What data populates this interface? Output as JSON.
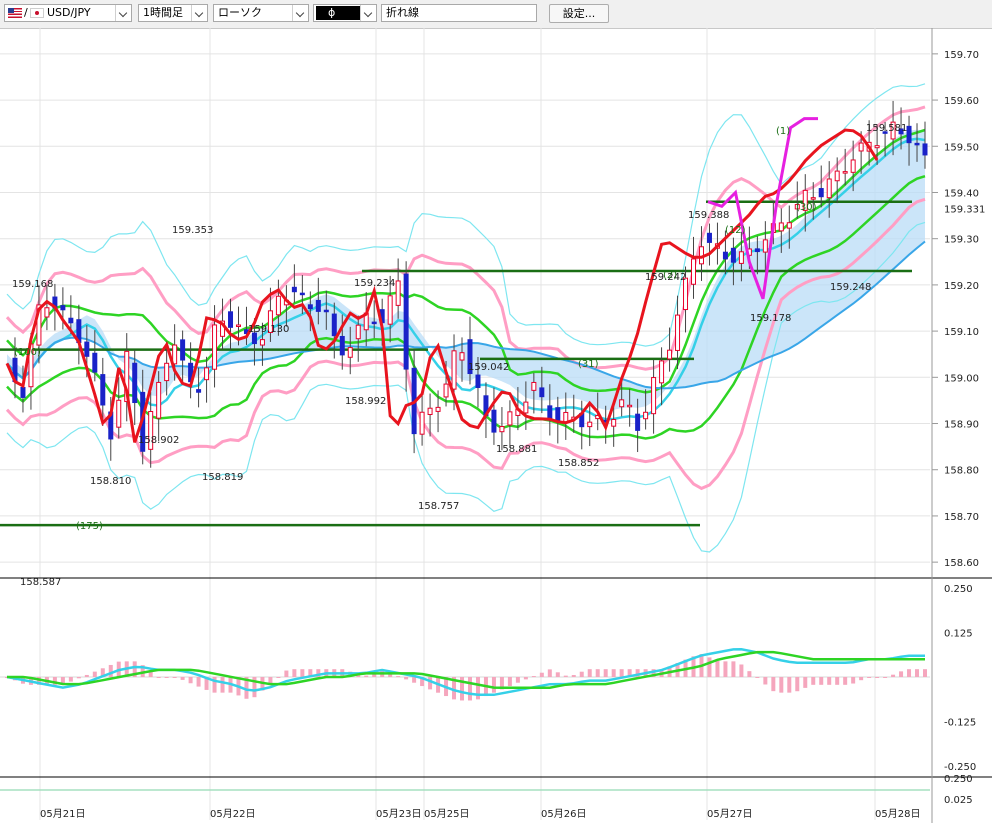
{
  "toolbar": {
    "symbol": "USD/JPY",
    "timeframe": "1時間足",
    "chart_type": "ローソク",
    "indicator": "ϕ",
    "line_type": "折れ線",
    "settings_label": "設定..."
  },
  "colors": {
    "candle_up": "#e8002a",
    "candle_down": "#1a22c8",
    "price_red": "#e8141e",
    "bb_inner": "#ff9ec4",
    "bb_outer": "#7ee6f0",
    "green_line": "#2ed424",
    "cyan_line": "#35d0e8",
    "blue_line": "#39a6e8",
    "magenta": "#e620e0",
    "cloud": "#b9dcf7",
    "cloud_pink": "#ffc8dc",
    "dark_green": "#1a6e14"
  },
  "chart_data": [
    {
      "type": "line",
      "title": "",
      "x_dates": [
        "05月21日",
        "05月22日",
        "05月23日",
        "05月25日",
        "05月26日",
        "05月27日",
        "05月28日"
      ],
      "ylim": [
        158.57,
        159.73
      ],
      "yticks": [
        "159.70",
        "159.60",
        "159.50",
        "159.40",
        "159.30",
        "159.20",
        "159.10",
        "159.00",
        "158.90",
        "158.80",
        "158.70",
        "158.60"
      ],
      "current_price": "159.331",
      "value_labels": [
        "159.168",
        "159.353",
        "159.130",
        "159.234",
        "159.042",
        "159.242",
        "159.388",
        "159.581",
        "159.178",
        "159.248",
        "158.992",
        "158.902",
        "158.810",
        "158.819",
        "158.757",
        "158.881",
        "158.852",
        "158.587"
      ],
      "period_labels": [
        "(100)",
        "(175)",
        "(31)",
        "(30)",
        "(12)",
        "(1)",
        "(2)"
      ],
      "horizontal_levels": [
        {
          "label": "(175)",
          "value": 158.68
        },
        {
          "label": "(100)",
          "value": 159.06
        },
        {
          "label": "",
          "value": 159.23
        },
        {
          "label": "(31)",
          "value": 159.04
        },
        {
          "label": "(30)",
          "value": 159.38
        }
      ],
      "price_line": [
        159.03,
        158.96,
        159.14,
        159.17,
        159.12,
        159.08,
        158.98,
        158.87,
        159.05,
        158.85,
        158.97,
        159.09,
        158.99,
        158.98,
        159.13,
        159.12,
        159.08,
        159.09,
        159.17,
        159.19,
        159.15,
        159.16,
        159.05,
        159.08,
        159.14,
        159.12,
        159.21,
        158.87,
        158.94,
        158.95,
        159.09,
        158.99,
        158.9,
        158.89,
        158.94,
        158.98,
        158.92,
        158.91,
        158.91,
        158.9,
        158.91,
        158.95,
        158.89,
        158.99,
        159.07,
        159.19,
        159.3,
        159.28,
        159.26,
        159.26,
        159.29,
        159.32,
        159.35,
        159.39,
        159.4,
        159.43,
        159.47,
        159.5,
        159.52,
        159.54,
        159.52,
        159.47
      ],
      "magenta_line": [
        159.38,
        159.37,
        159.4,
        159.25,
        159.17,
        159.38,
        159.54,
        159.56,
        159.56
      ]
    },
    {
      "type": "line",
      "title": "",
      "yticks": [
        "0.250",
        "0.125",
        "-0.125",
        "-0.250"
      ],
      "ylim": [
        -0.27,
        0.27
      ],
      "series": [
        {
          "values": [
            0.0,
            -0.01,
            -0.02,
            -0.03,
            -0.02,
            0.0,
            0.02,
            0.03,
            0.02,
            0.02,
            0.01,
            -0.01,
            -0.02,
            -0.04,
            -0.03,
            -0.01,
            0.0,
            0.01,
            0.01,
            0.01,
            0.02,
            0.01,
            0.0,
            -0.02,
            -0.04,
            -0.05,
            -0.05,
            -0.04,
            -0.03,
            -0.02,
            -0.02,
            -0.01,
            -0.01,
            0.0,
            0.01,
            0.02,
            0.04,
            0.06,
            0.07,
            0.08,
            0.07,
            0.05,
            0.04,
            0.04,
            0.04,
            0.04,
            0.05,
            0.05,
            0.06,
            0.06
          ]
        },
        {
          "values": [
            0.0,
            0.0,
            -0.01,
            -0.02,
            -0.02,
            -0.01,
            0.0,
            0.01,
            0.02,
            0.02,
            0.02,
            0.01,
            0.0,
            -0.01,
            -0.02,
            -0.02,
            -0.01,
            0.0,
            0.0,
            0.01,
            0.01,
            0.01,
            0.01,
            0.0,
            -0.01,
            -0.02,
            -0.03,
            -0.03,
            -0.03,
            -0.03,
            -0.02,
            -0.02,
            -0.02,
            -0.01,
            0.0,
            0.01,
            0.02,
            0.03,
            0.05,
            0.06,
            0.07,
            0.07,
            0.06,
            0.05,
            0.05,
            0.05,
            0.05,
            0.05,
            0.05,
            0.05
          ]
        }
      ]
    },
    {
      "type": "line",
      "title": "",
      "yticks": [
        "0.250",
        "0.025"
      ]
    }
  ]
}
